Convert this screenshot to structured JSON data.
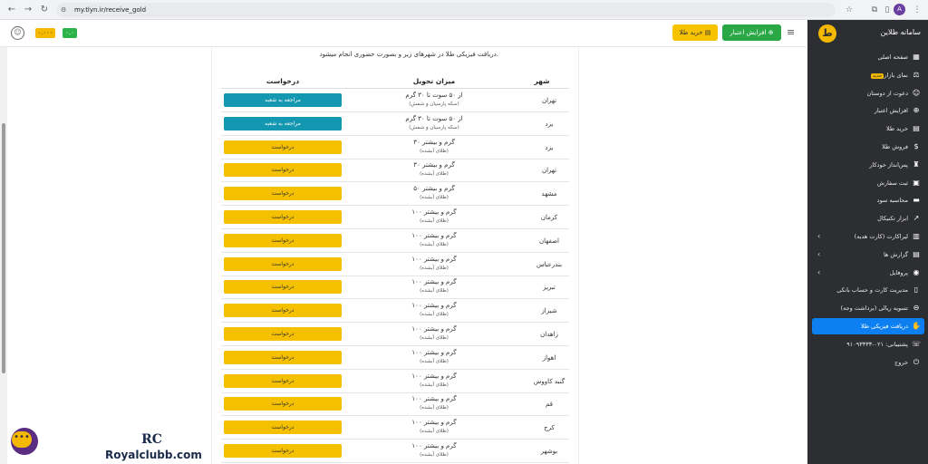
{
  "browser": {
    "url": "my.tlyn.ir/receive_gold",
    "avatar_letter": "A"
  },
  "topbar": {
    "buy_gold": "خرید طلا",
    "increase_credit": "افزایش اعتبار",
    "balance_yellow": "۰.۰۰۰",
    "balance_green": "۰.۰"
  },
  "page": {
    "intro": "دریافت فیزیکی طلا در شهرهای زیر و بصورت حضوری انجام میشود.",
    "col_city": "شهر",
    "col_amount": "میزان تحویل",
    "col_request": "درخواست",
    "rows": [
      {
        "city": "تهران",
        "amount": "از ۵۰ سوت تا ۳۰ گرم",
        "sub": "(سکه پارسیان و شمش)",
        "btn": "مراجعه به شعبه",
        "style": "t"
      },
      {
        "city": "یزد",
        "amount": "از ۵۰ سوت تا ۳۰ گرم",
        "sub": "(سکه پارسیان و شمش)",
        "btn": "مراجعه به شعبه",
        "style": "t"
      },
      {
        "city": "یزد",
        "amount": "۳۰ گرم و بیشتر",
        "sub": "(طلای آبشده)",
        "btn": "درخواست",
        "style": "y"
      },
      {
        "city": "تهران",
        "amount": "۳۰ گرم و بیشتر",
        "sub": "(طلای آبشده)",
        "btn": "درخواست",
        "style": "y"
      },
      {
        "city": "مشهد",
        "amount": "۵۰ گرم و بیشتر",
        "sub": "(طلای آبشده)",
        "btn": "درخواست",
        "style": "y"
      },
      {
        "city": "کرمان",
        "amount": "۱۰۰ گرم و بیشتر",
        "sub": "(طلای آبشده)",
        "btn": "درخواست",
        "style": "y"
      },
      {
        "city": "اصفهان",
        "amount": "۱۰۰ گرم و بیشتر",
        "sub": "(طلای آبشده)",
        "btn": "درخواست",
        "style": "y"
      },
      {
        "city": "بندرعباس",
        "amount": "۱۰۰ گرم و بیشتر",
        "sub": "(طلای آبشده)",
        "btn": "درخواست",
        "style": "y"
      },
      {
        "city": "تبریز",
        "amount": "۱۰۰ گرم و بیشتر",
        "sub": "(طلای آبشده)",
        "btn": "درخواست",
        "style": "y"
      },
      {
        "city": "شیراز",
        "amount": "۱۰۰ گرم و بیشتر",
        "sub": "(طلای آبشده)",
        "btn": "درخواست",
        "style": "y"
      },
      {
        "city": "زاهدان",
        "amount": "۱۰۰ گرم و بیشتر",
        "sub": "(طلای آبشده)",
        "btn": "درخواست",
        "style": "y"
      },
      {
        "city": "اهواز",
        "amount": "۱۰۰ گرم و بیشتر",
        "sub": "(طلای آبشده)",
        "btn": "درخواست",
        "style": "y"
      },
      {
        "city": "گنبد کاووس",
        "amount": "۱۰۰ گرم و بیشتر",
        "sub": "(طلای آبشده)",
        "btn": "درخواست",
        "style": "y"
      },
      {
        "city": "قم",
        "amount": "۱۰۰ گرم و بیشتر",
        "sub": "(طلای آبشده)",
        "btn": "درخواست",
        "style": "y"
      },
      {
        "city": "کرج",
        "amount": "۱۰۰ گرم و بیشتر",
        "sub": "(طلای آبشده)",
        "btn": "درخواست",
        "style": "y"
      },
      {
        "city": "بوشهر",
        "amount": "۱۰۰ گرم و بیشتر",
        "sub": "(طلای آبشده)",
        "btn": "درخواست",
        "style": "y"
      }
    ]
  },
  "sidebar": {
    "title": "سامانه طلاین",
    "items": [
      {
        "label": "صفحه اصلی",
        "icon": "grid-icon",
        "glyph": "▦"
      },
      {
        "label": "نمای بازار",
        "icon": "market-icon",
        "glyph": "⚖",
        "tag": "جدید"
      },
      {
        "label": "دعوت از دوستان",
        "icon": "users-icon",
        "glyph": "☺"
      },
      {
        "label": "افزایش اعتبار",
        "icon": "plus-circle-icon",
        "glyph": "⊕"
      },
      {
        "label": "خرید طلا",
        "icon": "gold-icon",
        "glyph": "▤"
      },
      {
        "label": "فروش طلا",
        "icon": "bag-icon",
        "glyph": "$"
      },
      {
        "label": "پس‌انداز خودکار",
        "icon": "piggy-icon",
        "glyph": "♜"
      },
      {
        "label": "ثبت سفارش",
        "icon": "clipboard-icon",
        "glyph": "▣"
      },
      {
        "label": "محاسبه سود",
        "icon": "chart-icon",
        "glyph": "▬"
      },
      {
        "label": "ابزار تکنیکال",
        "icon": "trend-icon",
        "glyph": "↗"
      },
      {
        "label": "لیراکارت (کارت هدیه)",
        "icon": "gift-icon",
        "glyph": "▥",
        "chev": true
      },
      {
        "label": "گزارش ها",
        "icon": "report-icon",
        "glyph": "▤",
        "chev": true
      },
      {
        "label": "پروفایل",
        "icon": "profile-icon",
        "glyph": "◉",
        "chev": true
      },
      {
        "label": "مدیریت کارت و حساب بانکی",
        "icon": "card-icon",
        "glyph": "▯"
      },
      {
        "label": "تسویه ریالی (برداشت وجه)",
        "icon": "withdraw-icon",
        "glyph": "⊖"
      },
      {
        "label": "دریافت فیزیکی طلا",
        "icon": "hand-gold-icon",
        "glyph": "✋",
        "active": true
      },
      {
        "label": "پشتیبانی: ۰۲۱-۹۱۰۹۳۳۳۳",
        "icon": "headset-icon",
        "glyph": "☏"
      },
      {
        "label": "خروج",
        "icon": "power-icon",
        "glyph": "⏻"
      }
    ]
  },
  "watermark": {
    "logo": "RC",
    "text": "Royalclubb.com"
  }
}
